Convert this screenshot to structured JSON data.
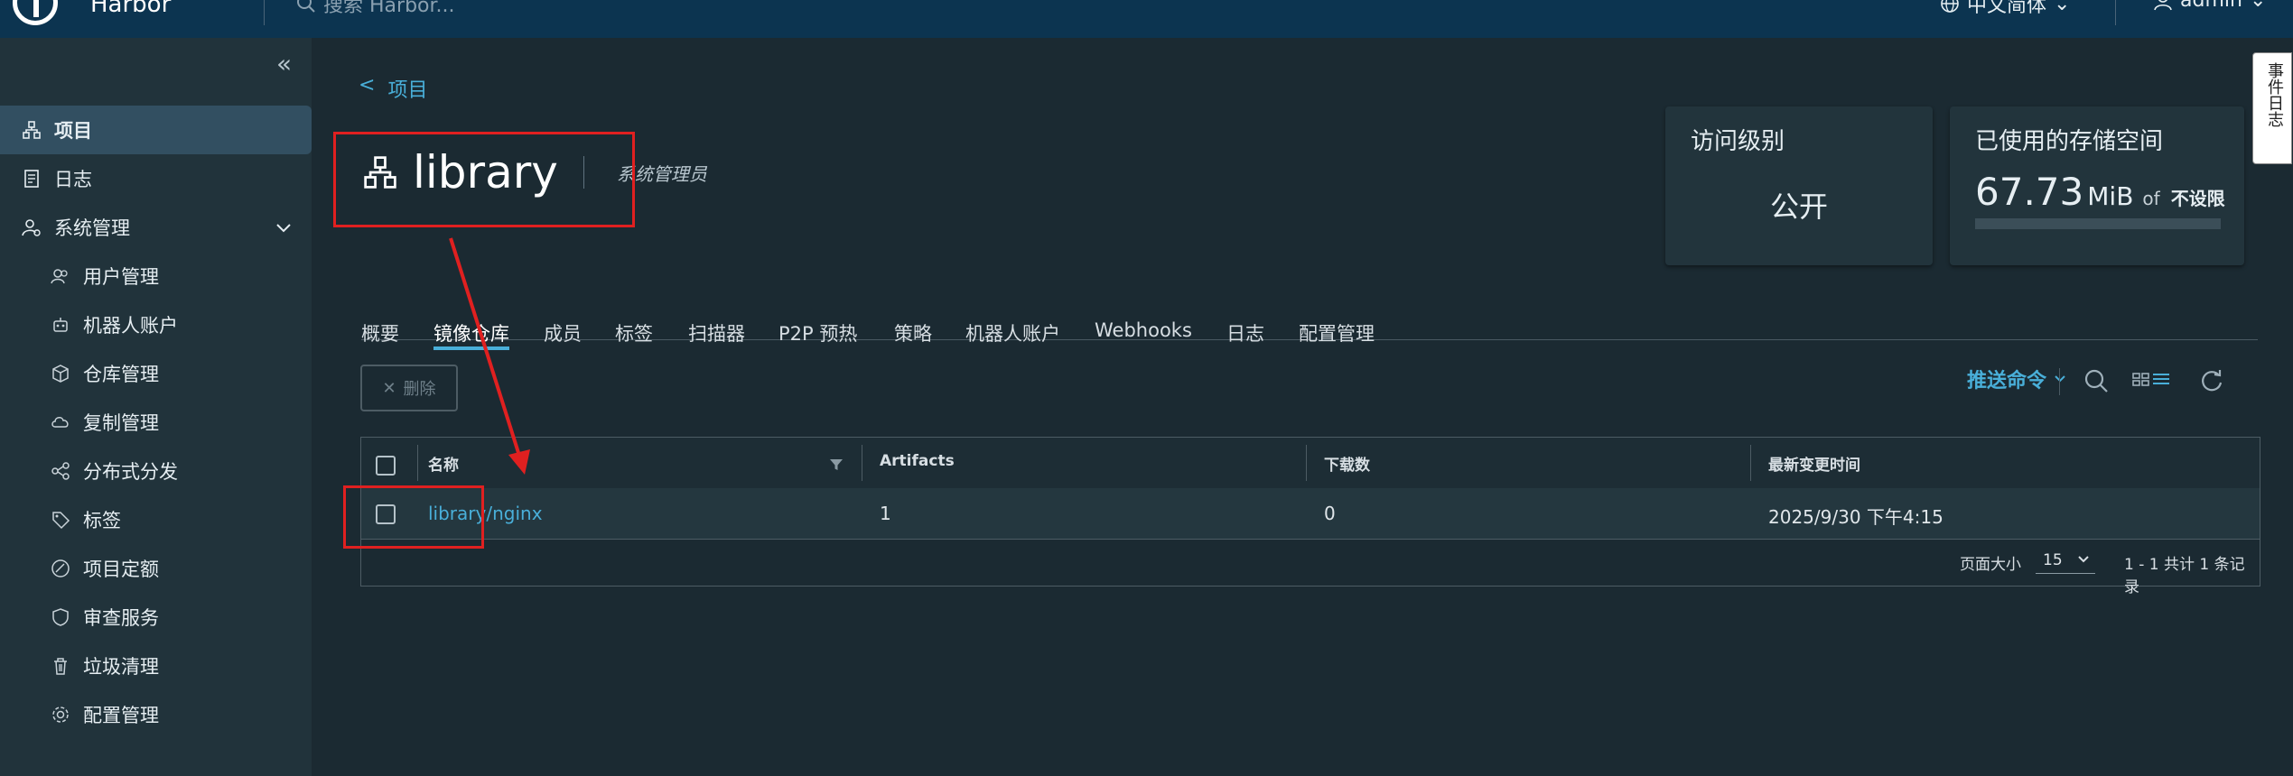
{
  "header": {
    "brand": "Harbor",
    "search_placeholder": "搜索 Harbor...",
    "language": "中文简体",
    "user": "admin"
  },
  "sidebar": {
    "items": [
      {
        "label": "项目",
        "icon": "projects-icon",
        "active": true
      },
      {
        "label": "日志",
        "icon": "log-icon"
      },
      {
        "label": "系统管理",
        "icon": "admin-icon",
        "expanded": true
      }
    ],
    "admin_items": [
      {
        "label": "用户管理",
        "icon": "users-icon"
      },
      {
        "label": "机器人账户",
        "icon": "robot-icon"
      },
      {
        "label": "仓库管理",
        "icon": "registry-icon"
      },
      {
        "label": "复制管理",
        "icon": "replication-icon"
      },
      {
        "label": "分布式分发",
        "icon": "distribution-icon"
      },
      {
        "label": "标签",
        "icon": "tag-icon"
      },
      {
        "label": "项目定额",
        "icon": "quota-icon"
      },
      {
        "label": "审查服务",
        "icon": "shield-icon"
      },
      {
        "label": "垃圾清理",
        "icon": "trash-icon"
      },
      {
        "label": "配置管理",
        "icon": "gear-icon"
      }
    ]
  },
  "breadcrumb": {
    "back_symbol": "<",
    "label": "项目"
  },
  "project": {
    "name": "library",
    "role": "系统管理员"
  },
  "cards": {
    "access_label": "访问级别",
    "access_value": "公开",
    "storage_label": "已使用的存储空间",
    "storage_value": "67.73",
    "storage_unit": "MiB",
    "storage_of": "of",
    "storage_limit": "不设限",
    "storage_used_fraction": 0
  },
  "tabs": [
    "概要",
    "镜像仓库",
    "成员",
    "标签",
    "扫描器",
    "P2P 预热",
    "策略",
    "机器人账户",
    "Webhooks",
    "日志",
    "配置管理"
  ],
  "active_tab": "镜像仓库",
  "toolbar": {
    "delete_label": "删除",
    "push_label": "推送命令"
  },
  "table": {
    "headers": [
      "名称",
      "Artifacts",
      "下载数",
      "最新变更时间"
    ],
    "rows": [
      {
        "name": "library/nginx",
        "artifacts": "1",
        "pulls": "0",
        "updated": "2025/9/30 下午4:15"
      }
    ],
    "page_size_label": "页面大小",
    "page_size": "15",
    "summary": "1 - 1 共计 1 条记录"
  },
  "side_tab": "事件日志",
  "colors": {
    "accent": "#49afd9",
    "annotation": "#e02020",
    "header_bg": "#0c3450",
    "sidebar_bg": "#21333b"
  }
}
